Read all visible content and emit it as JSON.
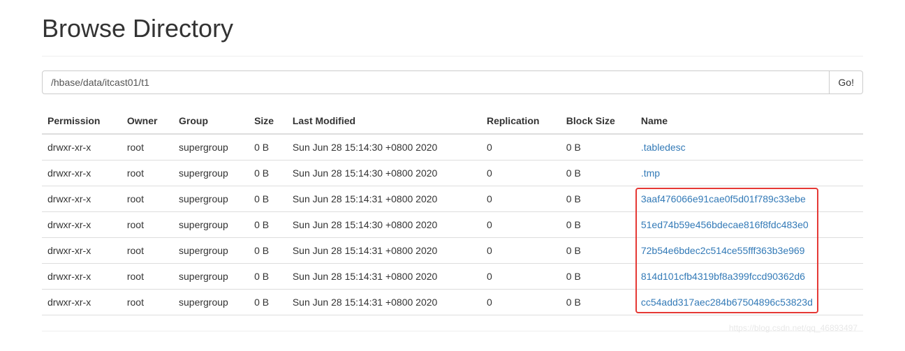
{
  "page": {
    "title": "Browse Directory",
    "watermark": "https://blog.csdn.net/qq_46893497"
  },
  "input": {
    "path_value": "/hbase/data/itcast01/t1",
    "go_label": "Go!"
  },
  "table": {
    "headers": {
      "permission": "Permission",
      "owner": "Owner",
      "group": "Group",
      "size": "Size",
      "last_modified": "Last Modified",
      "replication": "Replication",
      "block_size": "Block Size",
      "name": "Name"
    },
    "rows": [
      {
        "permission": "drwxr-xr-x",
        "owner": "root",
        "group": "supergroup",
        "size": "0 B",
        "last_modified": "Sun Jun 28 15:14:30 +0800 2020",
        "replication": "0",
        "block_size": "0 B",
        "name": ".tabledesc",
        "highlighted": false
      },
      {
        "permission": "drwxr-xr-x",
        "owner": "root",
        "group": "supergroup",
        "size": "0 B",
        "last_modified": "Sun Jun 28 15:14:30 +0800 2020",
        "replication": "0",
        "block_size": "0 B",
        "name": ".tmp",
        "highlighted": false
      },
      {
        "permission": "drwxr-xr-x",
        "owner": "root",
        "group": "supergroup",
        "size": "0 B",
        "last_modified": "Sun Jun 28 15:14:31 +0800 2020",
        "replication": "0",
        "block_size": "0 B",
        "name": "3aaf476066e91cae0f5d01f789c33ebe",
        "highlighted": true
      },
      {
        "permission": "drwxr-xr-x",
        "owner": "root",
        "group": "supergroup",
        "size": "0 B",
        "last_modified": "Sun Jun 28 15:14:30 +0800 2020",
        "replication": "0",
        "block_size": "0 B",
        "name": "51ed74b59e456bdecae816f8fdc483e0",
        "highlighted": true
      },
      {
        "permission": "drwxr-xr-x",
        "owner": "root",
        "group": "supergroup",
        "size": "0 B",
        "last_modified": "Sun Jun 28 15:14:31 +0800 2020",
        "replication": "0",
        "block_size": "0 B",
        "name": "72b54e6bdec2c514ce55fff363b3e969",
        "highlighted": true
      },
      {
        "permission": "drwxr-xr-x",
        "owner": "root",
        "group": "supergroup",
        "size": "0 B",
        "last_modified": "Sun Jun 28 15:14:31 +0800 2020",
        "replication": "0",
        "block_size": "0 B",
        "name": "814d101cfb4319bf8a399fccd90362d6",
        "highlighted": true
      },
      {
        "permission": "drwxr-xr-x",
        "owner": "root",
        "group": "supergroup",
        "size": "0 B",
        "last_modified": "Sun Jun 28 15:14:31 +0800 2020",
        "replication": "0",
        "block_size": "0 B",
        "name": "cc54add317aec284b67504896c53823d",
        "highlighted": true
      }
    ]
  }
}
